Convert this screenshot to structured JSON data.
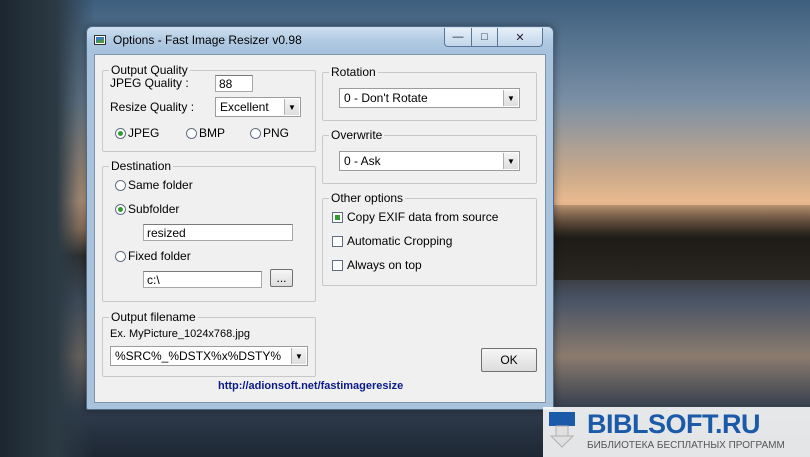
{
  "window": {
    "title": "Options - Fast Image Resizer v0.98",
    "app_icon": "app-icon"
  },
  "title_controls": {
    "minimize": "—",
    "maximize": "□",
    "close": "✕"
  },
  "output_quality": {
    "legend": "Output Quality",
    "jpeg_quality_label": "JPEG Quality :",
    "jpeg_quality_value": "88",
    "resize_quality_label": "Resize Quality :",
    "resize_quality_value": "Excellent",
    "formats": {
      "jpeg": "JPEG",
      "bmp": "BMP",
      "png": "PNG",
      "selected": "JPEG"
    }
  },
  "destination": {
    "legend": "Destination",
    "same_folder": "Same folder",
    "subfolder": "Subfolder",
    "subfolder_value": "resized",
    "fixed_folder": "Fixed folder",
    "fixed_folder_value": "c:\\",
    "browse_label": "...",
    "selected": "Subfolder"
  },
  "output_filename": {
    "legend": "Output filename",
    "example": "Ex. MyPicture_1024x768.jpg",
    "pattern": "%SRC%_%DSTX%x%DSTY%"
  },
  "rotation": {
    "legend": "Rotation",
    "value": "0 - Don't Rotate"
  },
  "overwrite": {
    "legend": "Overwrite",
    "value": "0 - Ask"
  },
  "other_options": {
    "legend": "Other options",
    "copy_exif": "Copy EXIF data from source",
    "copy_exif_checked": true,
    "auto_crop": "Automatic Cropping",
    "auto_crop_checked": false,
    "always_on_top": "Always on top",
    "always_on_top_checked": false
  },
  "ok_label": "OK",
  "link": "http://adionsoft.net/fastimageresize",
  "watermark": {
    "title": "BIBLSOFT.RU",
    "subtitle": "БИБЛИОТЕКА БЕСПЛАТНЫХ ПРОГРАММ"
  },
  "colors": {
    "accent_green": "#2f9e2f",
    "link_blue": "#0a1a8a",
    "watermark_blue": "#1a5aa8"
  }
}
